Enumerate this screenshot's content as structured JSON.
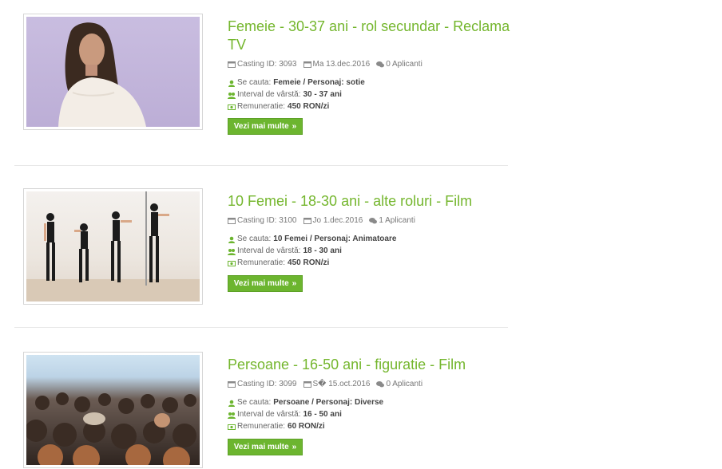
{
  "listings": [
    {
      "title": "Femeie - 30-37 ani - rol secundar - Reclama TV",
      "casting_id": "Casting ID: 3093",
      "date": "Ma 13.dec.2016",
      "applicants": "0 Aplicanti",
      "seeking_label": "Se cauta:",
      "seeking_value": "Femeie / Personaj: sotie",
      "age_label": "Interval de vârstă:",
      "age_value": "30 - 37 ani",
      "pay_label": "Remuneratie:",
      "pay_value": "450 RON/zi",
      "button": "Vezi mai multe"
    },
    {
      "title": "10 Femei - 18-30 ani - alte roluri - Film",
      "casting_id": "Casting ID: 3100",
      "date": "Jo 1.dec.2016",
      "applicants": "1 Aplicanti",
      "seeking_label": "Se cauta:",
      "seeking_value": "10 Femei / Personaj: Animatoare",
      "age_label": "Interval de vârstă:",
      "age_value": "18 - 30 ani",
      "pay_label": "Remuneratie:",
      "pay_value": "450 RON/zi",
      "button": "Vezi mai multe"
    },
    {
      "title": "Persoane - 16-50 ani - figuratie - Film",
      "casting_id": "Casting ID: 3099",
      "date": "S� 15.oct.2016",
      "applicants": "0 Aplicanti",
      "seeking_label": "Se cauta:",
      "seeking_value": "Persoane / Personaj: Diverse",
      "age_label": "Interval de vârstă:",
      "age_value": "16 - 50 ani",
      "pay_label": "Remuneratie:",
      "pay_value": "60 RON/zi",
      "button": "Vezi mai multe"
    }
  ],
  "colors": {
    "accent": "#74b62d",
    "button": "#6cb52f"
  },
  "icons": [
    "calendar-icon",
    "comments-icon",
    "user-icon",
    "users-icon",
    "money-icon",
    "chevron-right-icon"
  ]
}
